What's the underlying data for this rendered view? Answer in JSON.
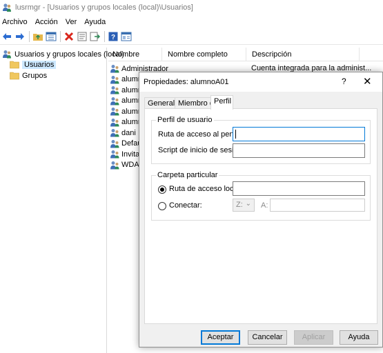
{
  "window": {
    "title": "lusrmgr - [Usuarios y grupos locales (local)\\Usuarios]",
    "menu": [
      "Archivo",
      "Acción",
      "Ver",
      "Ayuda"
    ]
  },
  "tree": {
    "root": "Usuarios y grupos locales (local)",
    "items": [
      "Usuarios",
      "Grupos"
    ]
  },
  "list": {
    "columns": [
      "Nombre",
      "Nombre completo",
      "Descripción"
    ],
    "rows": [
      {
        "name": "Administrador",
        "desc": "Cuenta integrada para la administ..."
      },
      {
        "name": "alumn",
        "desc": ""
      },
      {
        "name": "alumn",
        "desc": ""
      },
      {
        "name": "alumn",
        "desc": ""
      },
      {
        "name": "alumn",
        "desc": ""
      },
      {
        "name": "alumn",
        "desc": ""
      },
      {
        "name": "dani",
        "desc": ""
      },
      {
        "name": "Defau",
        "desc": ""
      },
      {
        "name": "Invita",
        "desc": ""
      },
      {
        "name": "WDAC",
        "desc": ""
      }
    ]
  },
  "dialog": {
    "title": "Propiedades: alumnoA01",
    "help": "?",
    "close": "✕",
    "tabs": [
      "General",
      "Miembro de",
      "Perfil"
    ],
    "active_tab": "Perfil",
    "profile_group": {
      "label": "Perfil de usuario",
      "profile_path_label": "Ruta de acceso al perfil:",
      "profile_path_value": "",
      "logon_script_label": "Script de inicio de sesión:",
      "logon_script_value": ""
    },
    "home_group": {
      "label": "Carpeta particular",
      "local_path_label": "Ruta de acceso local:",
      "local_path_value": "",
      "connect_label": "Conectar:",
      "drive_value": "Z:",
      "to_label": "A:",
      "to_value": ""
    },
    "buttons": {
      "ok": "Aceptar",
      "cancel": "Cancelar",
      "apply": "Aplicar",
      "help": "Ayuda"
    }
  },
  "colors": {
    "selection": "#cce8ff",
    "focus_border": "#0078d7",
    "dialog_bg": "#f0f0f0"
  }
}
